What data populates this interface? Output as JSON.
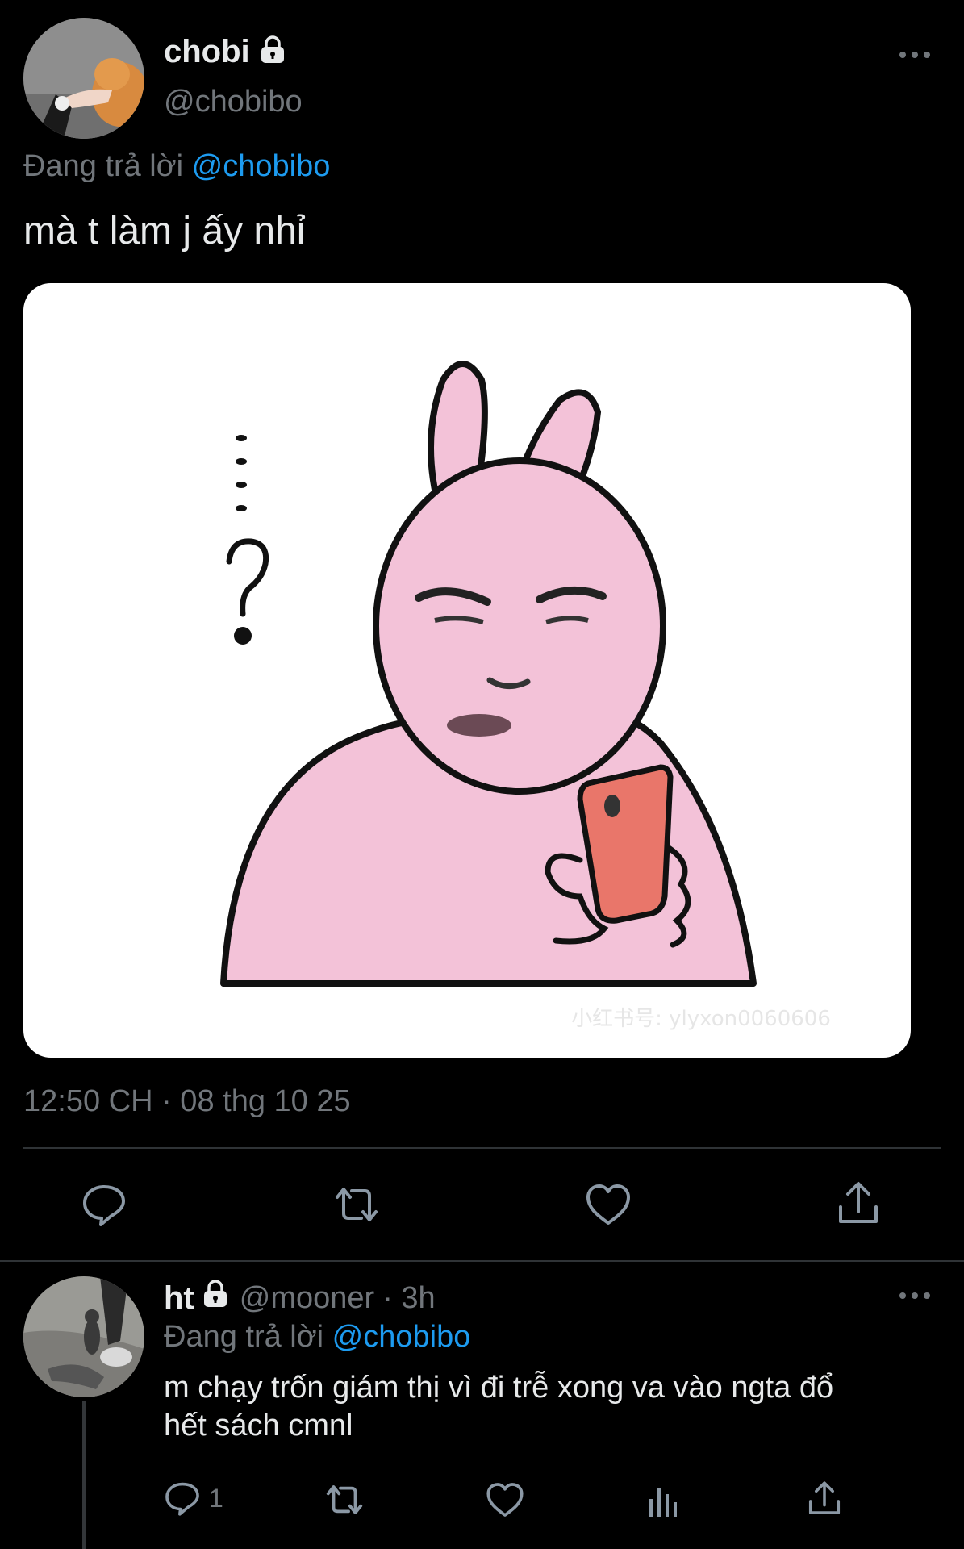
{
  "main_tweet": {
    "display_name": "chobi",
    "handle": "@chobibo",
    "replying_label": "Đang trả lời",
    "replying_to": "@chobibo",
    "text": "mà t làm j ấy nhỉ",
    "image_description": "pink bunny sticker with phone",
    "image_watermark": "小红书号: ylyxon0060606",
    "timestamp": "12:50 CH · 08 thg 10 25"
  },
  "reply_tweet": {
    "display_name": "ht",
    "handle": "@mooner",
    "time": "· 3h",
    "replying_label": "Đang trả lời",
    "replying_to": "@chobibo",
    "text_line1": "m chạy trốn giám thị vì đi trễ xong va vào ngta đổ",
    "text_line2": "hết sách cmnl",
    "reply_count": "1"
  },
  "icons": {
    "lock": "lock-icon",
    "more": "more-icon",
    "reply": "reply-icon",
    "retweet": "retweet-icon",
    "like": "like-icon",
    "share": "share-icon",
    "analytics": "analytics-icon"
  },
  "colors": {
    "background": "#000000",
    "link": "#1d9bf0",
    "muted": "#71767b",
    "bunny": "#f3c2d8",
    "phone": "#e9766a"
  }
}
